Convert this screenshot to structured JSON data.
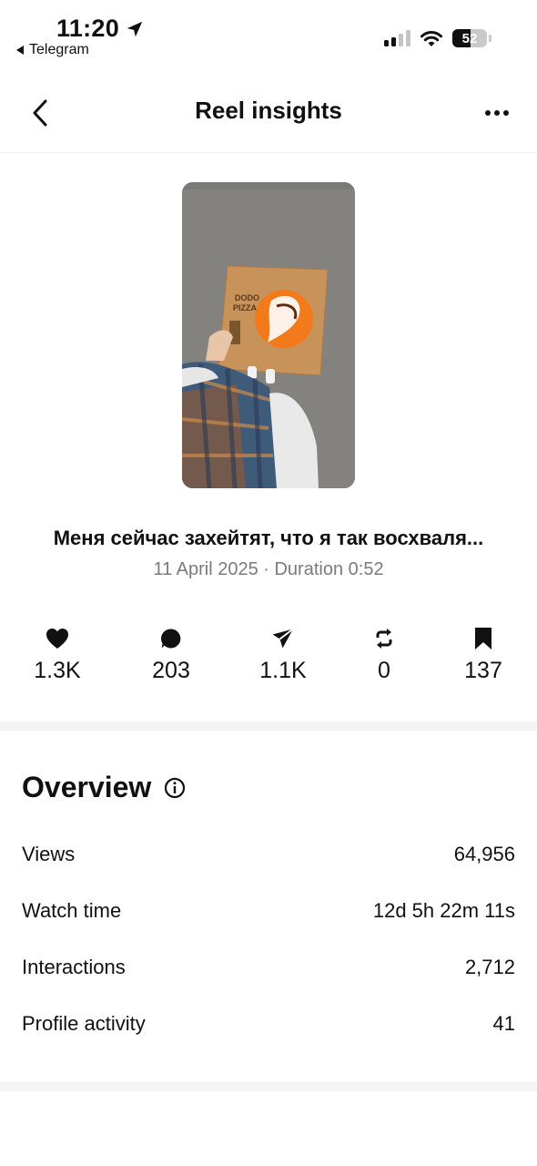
{
  "status_bar": {
    "time": "11:20",
    "back_app": "Telegram",
    "battery": "52"
  },
  "header": {
    "title": "Reel insights"
  },
  "reel": {
    "title": "Меня сейчас захейтят, что я так восхваля...",
    "meta": "11 April 2025 · Duration 0:52",
    "thumbnail_text": "DODO PIZZA"
  },
  "stats": [
    {
      "icon": "heart-icon",
      "value": "1.3K"
    },
    {
      "icon": "comment-icon",
      "value": "203"
    },
    {
      "icon": "share-icon",
      "value": "1.1K"
    },
    {
      "icon": "repost-icon",
      "value": "0"
    },
    {
      "icon": "bookmark-icon",
      "value": "137"
    }
  ],
  "overview": {
    "title": "Overview",
    "rows": [
      {
        "label": "Views",
        "value": "64,956"
      },
      {
        "label": "Watch time",
        "value": "12d 5h 22m 11s"
      },
      {
        "label": "Interactions",
        "value": "2,712"
      },
      {
        "label": "Profile activity",
        "value": "41"
      }
    ]
  },
  "colors": {
    "accent_orange": "#f27a1a",
    "divider": "#f4f4f4",
    "muted_text": "#7b7b7b"
  }
}
